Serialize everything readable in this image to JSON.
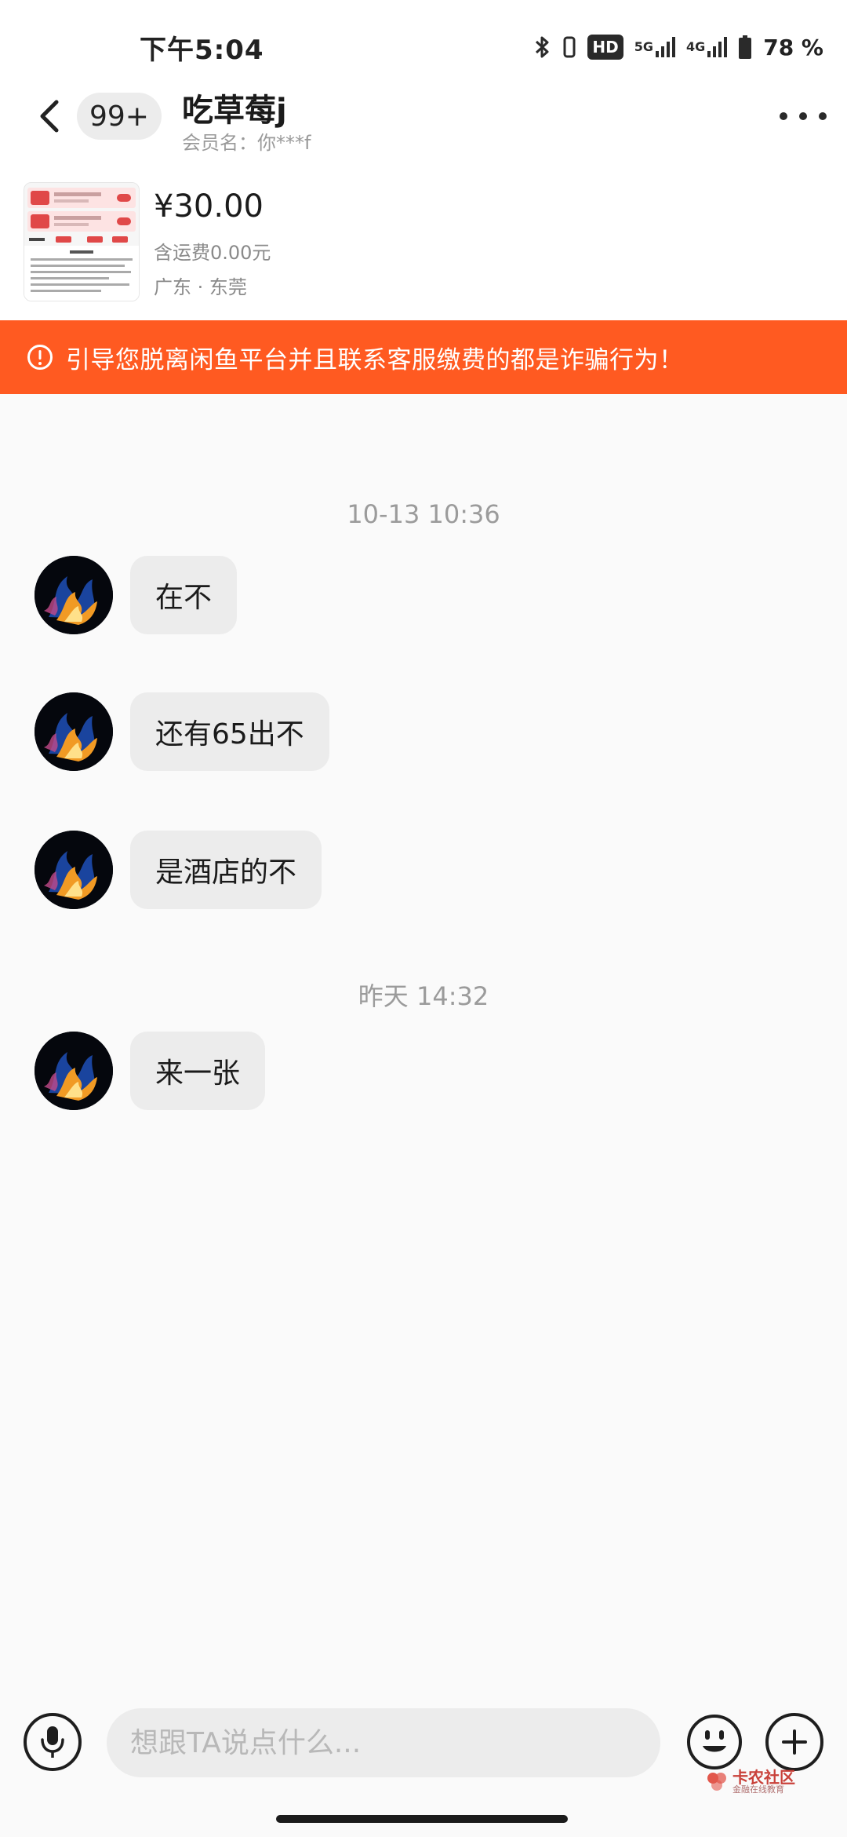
{
  "status_bar": {
    "time": "下午5:04",
    "hd_label": "HD",
    "network_1": "5G",
    "network_2": "4G",
    "battery": "78 %"
  },
  "header": {
    "unread_count": "99+",
    "title": "吃草莓j",
    "member_name": "会员名：你***f"
  },
  "product": {
    "price": "¥30.00",
    "shipping": "含运费0.00元",
    "location": "广东 · 东莞"
  },
  "warning": {
    "text": "引导您脱离闲鱼平台并且联系客服缴费的都是诈骗行为！",
    "color": "#ff5a21"
  },
  "messages": {
    "timestamp_1": "10-13 10:36",
    "msg_1": "在不",
    "msg_2": "还有65出不",
    "msg_3": "是酒店的不",
    "timestamp_2": "昨天 14:32",
    "msg_4": "来一张"
  },
  "input": {
    "placeholder": "想跟TA说点什么..."
  },
  "watermark": {
    "title": "卡农社区",
    "subtitle": "金融在线教育"
  }
}
